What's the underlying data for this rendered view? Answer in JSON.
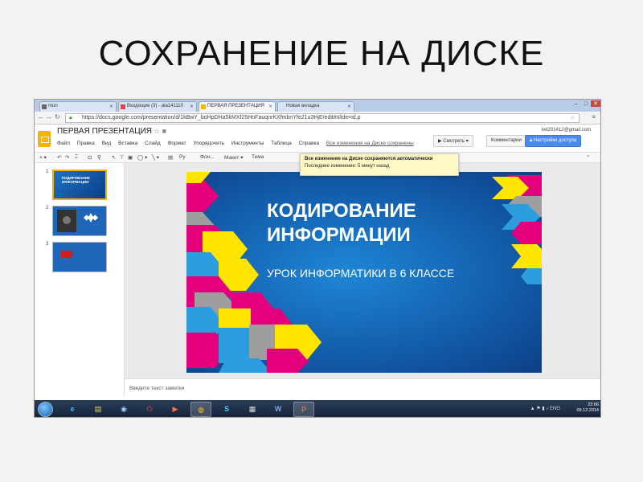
{
  "page": {
    "title": "СОХРАНЕНИЕ НА ДИСКЕ"
  },
  "browser": {
    "tabs": [
      {
        "label": "mun",
        "active": false
      },
      {
        "label": "Входящие (3) - ala141110",
        "active": false
      },
      {
        "label": "ПЕРВАЯ ПРЕЗЕНТАЦИЯ",
        "active": true
      },
      {
        "label": "Новая вкладка",
        "active": false
      }
    ],
    "url": "https://docs.google.com/presentation/d/1kBwY_boHpDHa5kMXf25HnFauqnrKXfmbnYfe21u3HjE/edit#slide=id.p"
  },
  "docs": {
    "title": "ПЕРВАЯ ПРЕЗЕНТАЦИЯ",
    "menu": [
      "Файл",
      "Правка",
      "Вид",
      "Вставка",
      "Слайд",
      "Формат",
      "Упорядочить",
      "Инструменты",
      "Таблица",
      "Справка"
    ],
    "save_status": "Все изменения на Диске сохранены",
    "user_email": "kel201412@gmail.com",
    "buttons": {
      "present": "Смотреть",
      "comments": "Комментарии",
      "share": "Настройки доступа"
    },
    "toolbar": {
      "font_label": "Фон...",
      "layout_label": "Макет",
      "theme_label": "Тема",
      "zoom_label": "Ру"
    }
  },
  "tooltip": {
    "title": "Все изменения на Диске сохраняются автоматически",
    "subtitle": "Последнее изменение: 5 минут назад"
  },
  "filmstrip": {
    "items": [
      {
        "number": "1"
      },
      {
        "number": "2"
      },
      {
        "number": "3"
      }
    ],
    "thumb1_text": "КОДИРОВАНИЕ ИНФОРМАЦИИ"
  },
  "slide": {
    "title_line1": "КОДИРОВАНИЕ",
    "title_line2": "ИНФОРМАЦИИ",
    "subtitle": "УРОК ИНФОРМАТИКИ В 6 КЛАССЕ"
  },
  "notes": {
    "placeholder": "Введите текст заметки"
  },
  "taskbar": {
    "lang": "ENG",
    "time": "23:06",
    "date": "09.12.2014"
  },
  "colors": {
    "accent_yellow": "#f4b400",
    "share_blue": "#4a8af4",
    "slide_blue": "#135fad",
    "tooltip_bg": "#fff8c4"
  }
}
